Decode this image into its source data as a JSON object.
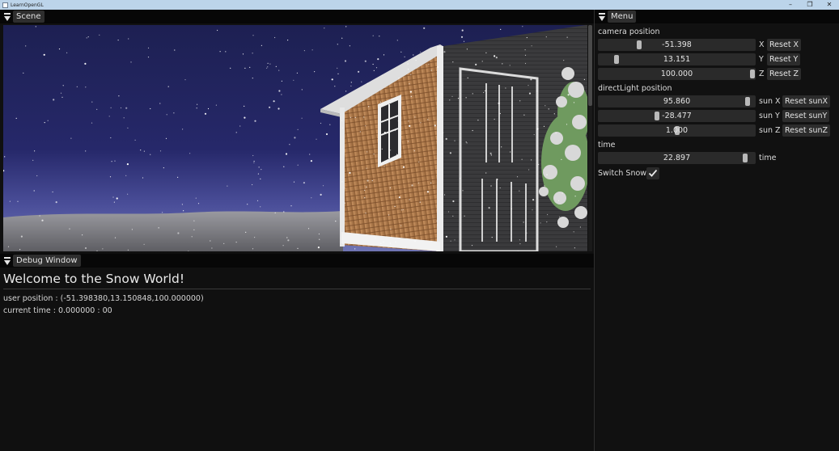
{
  "app": {
    "title": "LearnOpenGL"
  },
  "window_controls": {
    "minimize": "–",
    "maximize": "❐",
    "close": "✕"
  },
  "scene": {
    "tab": "Scene"
  },
  "debug": {
    "tab": "Debug Window",
    "welcome": "Welcome to the Snow World!",
    "user_position": "user position : (-51.398380,13.150848,100.000000)",
    "current_time": "current time : 0.000000 : 00"
  },
  "menu": {
    "tab": "Menu",
    "camera": {
      "label": "camera position",
      "x": {
        "value": "-51.398",
        "axis": "X",
        "reset": "Reset X",
        "fraction": 0.25
      },
      "y": {
        "value": "13.151",
        "axis": "Y",
        "reset": "Reset Y",
        "fraction": 0.1
      },
      "z": {
        "value": "100.000",
        "axis": "Z",
        "reset": "Reset Z",
        "fraction": 1.0
      }
    },
    "light": {
      "label": "directLight position",
      "x": {
        "value": "95.860",
        "axis": "sun X",
        "reset": "Reset sunX",
        "fraction": 0.97
      },
      "y": {
        "value": "-28.477",
        "axis": "sun Y",
        "reset": "Reset sunY",
        "fraction": 0.37
      },
      "z": {
        "value": "1.000",
        "axis": "sun Z",
        "reset": "Reset sunZ",
        "fraction": 0.5
      }
    },
    "time": {
      "label": "time",
      "value": "22.897",
      "axis": "time",
      "fraction": 0.95
    },
    "snow": {
      "label": "Switch Snow",
      "checked": true
    }
  }
}
